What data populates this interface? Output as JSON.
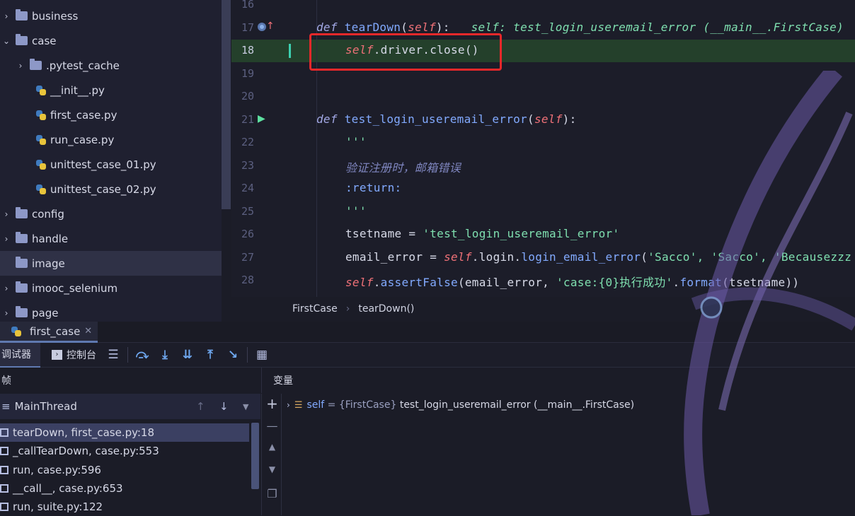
{
  "project_tree": [
    {
      "label": "business",
      "type": "folder",
      "expanded": false
    },
    {
      "label": "case",
      "type": "folder",
      "expanded": true
    },
    {
      "label": ".pytest_cache",
      "type": "folder",
      "expanded": false,
      "indent": 1
    },
    {
      "label": "__init__.py",
      "type": "python",
      "indent": 1
    },
    {
      "label": "first_case.py",
      "type": "python",
      "indent": 1
    },
    {
      "label": "run_case.py",
      "type": "python",
      "indent": 1
    },
    {
      "label": "unittest_case_01.py",
      "type": "python",
      "indent": 1
    },
    {
      "label": "unittest_case_02.py",
      "type": "python",
      "indent": 1
    },
    {
      "label": "config",
      "type": "folder",
      "expanded": false
    },
    {
      "label": "handle",
      "type": "folder",
      "expanded": false
    },
    {
      "label": "image",
      "type": "folder",
      "selected": true
    },
    {
      "label": "imooc_selenium",
      "type": "folder",
      "expanded": false
    },
    {
      "label": "page",
      "type": "folder",
      "expanded": false
    }
  ],
  "editor": {
    "line_numbers": [
      "16",
      "17",
      "18",
      "19",
      "20",
      "21",
      "22",
      "23",
      "24",
      "25",
      "26",
      "27",
      "28"
    ],
    "current_line": "18",
    "lines": {
      "l17_def": "def ",
      "l17_name": "tearDown",
      "l17_self": "self",
      "l17_end": "):",
      "l17_hint": "self: test_login_useremail_error (__main__.FirstCase)",
      "l18_self": "self",
      "l18_rest": ".driver.close()",
      "l21_def": "def ",
      "l21_name": "test_login_useremail_error",
      "l21_self": "self",
      "l21_end": "):",
      "l22": "'''",
      "l23": "验证注册时，邮箱错误",
      "l24": ":return:",
      "l25": "'''",
      "l26_a": "tsetname = ",
      "l26_str": "'test_login_useremail_error'",
      "l27_a": "email_error = ",
      "l27_self": "self",
      "l27_b": ".login.",
      "l27_m": "login_email_error",
      "l27_c": "(",
      "l27_str": "'Sacco', 'Sacco', 'Becausezzz",
      "l28_self": "self",
      "l28_b": ".",
      "l28_m": "assertFalse",
      "l28_c": "(email_error, ",
      "l28_str": "'case:{0}执行成功'",
      "l28_d": ".",
      "l28_m2": "format",
      "l28_e": "(tsetname))"
    }
  },
  "breadcrumb": [
    "FirstCase",
    "tearDown()"
  ],
  "run_tab": {
    "label": "first_case",
    "close": "✕"
  },
  "toolbar": {
    "debugger": "调试器",
    "console": "控制台",
    "icons": [
      "threads-icon",
      "step-over-icon",
      "step-into-icon",
      "step-into-my-code-icon",
      "step-out-icon",
      "run-to-cursor-icon",
      "evaluate-icon"
    ]
  },
  "frames": {
    "header": "帧",
    "thread": "MainThread",
    "items": [
      "tearDown, first_case.py:18",
      "_callTearDown, case.py:553",
      "run, case.py:596",
      "__call__, case.py:653",
      "run, suite.py:122"
    ]
  },
  "variables": {
    "header": "变量",
    "items": [
      {
        "name": "self",
        "value": " = {FirstCase} ",
        "detail": "test_login_useremail_error (__main__.FirstCase)"
      }
    ]
  },
  "colors": {
    "background": "#1b1c27",
    "selection": "#3b4062",
    "current_line": "#24402b",
    "highlight_box": "#e8282a",
    "accent": "#6fa8f0"
  }
}
